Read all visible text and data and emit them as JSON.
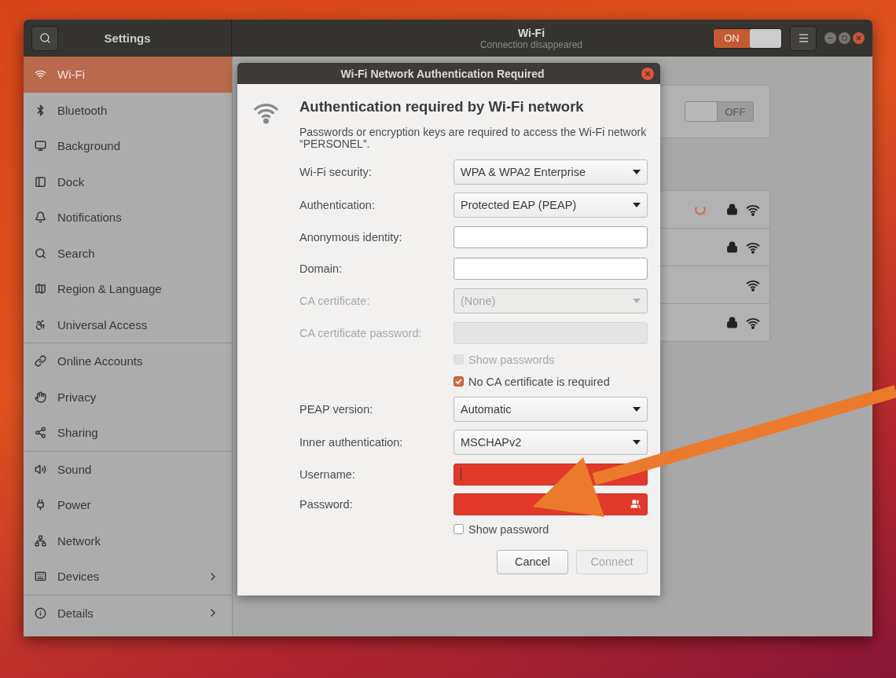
{
  "header": {
    "app_title": "Settings",
    "title": "Wi-Fi",
    "subtitle": "Connection disappeared",
    "wifi_switch": {
      "label": "ON",
      "on": true
    }
  },
  "sidebar": {
    "sections": [
      {
        "items": [
          {
            "label": "Wi-Fi",
            "selected": true,
            "has_submenu": false
          },
          {
            "label": "Bluetooth",
            "selected": false,
            "has_submenu": false
          },
          {
            "label": "Background",
            "selected": false,
            "has_submenu": false
          },
          {
            "label": "Dock",
            "selected": false,
            "has_submenu": false
          },
          {
            "label": "Notifications",
            "selected": false,
            "has_submenu": false
          },
          {
            "label": "Search",
            "selected": false,
            "has_submenu": false
          },
          {
            "label": "Region & Language",
            "selected": false,
            "has_submenu": false
          },
          {
            "label": "Universal Access",
            "selected": false,
            "has_submenu": false
          }
        ]
      },
      {
        "items": [
          {
            "label": "Online Accounts",
            "selected": false,
            "has_submenu": false
          },
          {
            "label": "Privacy",
            "selected": false,
            "has_submenu": false
          },
          {
            "label": "Sharing",
            "selected": false,
            "has_submenu": false
          }
        ]
      },
      {
        "items": [
          {
            "label": "Sound",
            "selected": false,
            "has_submenu": false
          },
          {
            "label": "Power",
            "selected": false,
            "has_submenu": false
          },
          {
            "label": "Network",
            "selected": false,
            "has_submenu": false
          },
          {
            "label": "Devices",
            "selected": false,
            "has_submenu": true
          }
        ]
      },
      {
        "items": [
          {
            "label": "Details",
            "selected": false,
            "has_submenu": true
          }
        ]
      }
    ]
  },
  "content": {
    "mode_switch": {
      "label": "OFF",
      "on": false
    },
    "networks": [
      {
        "connecting": true,
        "secured": true
      },
      {
        "connecting": false,
        "secured": true
      },
      {
        "connecting": false,
        "secured": false
      },
      {
        "connecting": false,
        "secured": true
      }
    ]
  },
  "dialog": {
    "title": "Wi-Fi Network Authentication Required",
    "heading": "Authentication required by Wi-Fi network",
    "message": "Passwords or encryption keys are required to access the Wi-Fi network “PERSONEL”.",
    "fields": [
      {
        "kind": "dropdown",
        "label": "Wi-Fi security:",
        "value": "WPA & WPA2 Enterprise",
        "disabled": false
      },
      {
        "kind": "dropdown",
        "label": "Authentication:",
        "value": "Protected EAP (PEAP)",
        "disabled": false
      },
      {
        "kind": "entry",
        "label": "Anonymous identity:",
        "disabled": false,
        "error": false
      },
      {
        "kind": "entry",
        "label": "Domain:",
        "disabled": false,
        "error": false
      },
      {
        "kind": "dropdown",
        "label": "CA certificate:",
        "value": "(None)",
        "disabled": true
      },
      {
        "kind": "entry",
        "label": "CA certificate password:",
        "disabled": true,
        "error": false
      },
      {
        "kind": "checkbox",
        "label": "Show passwords",
        "checked": false,
        "disabled": true
      },
      {
        "kind": "checkbox",
        "label": "No CA certificate is required",
        "checked": true,
        "disabled": false
      },
      {
        "kind": "dropdown",
        "label": "PEAP version:",
        "value": "Automatic",
        "disabled": false
      },
      {
        "kind": "dropdown",
        "label": "Inner authentication:",
        "value": "MSCHAPv2",
        "disabled": false
      },
      {
        "kind": "entry",
        "label": "Username:",
        "disabled": false,
        "error": true,
        "focused": true
      },
      {
        "kind": "password",
        "label": "Password:",
        "disabled": false,
        "error": true
      },
      {
        "kind": "checkbox",
        "label": "Show password",
        "checked": false,
        "disabled": false
      }
    ],
    "buttons": [
      {
        "label": "Cancel",
        "disabled": false
      },
      {
        "label": "Connect",
        "disabled": true
      }
    ]
  }
}
